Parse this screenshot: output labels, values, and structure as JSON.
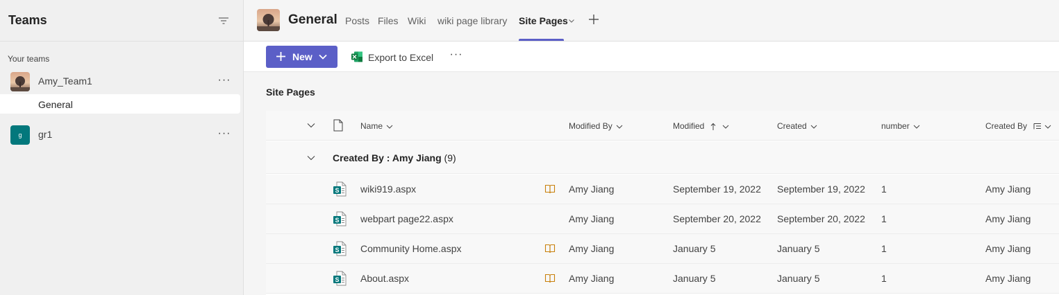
{
  "sidebar": {
    "title": "Teams",
    "section_label": "Your teams",
    "teams": [
      {
        "name": "Amy_Team1",
        "channels": [
          "General"
        ]
      },
      {
        "name": "gr1",
        "avatar_letter": "g"
      }
    ]
  },
  "header": {
    "channel_title": "General",
    "tabs": [
      "Posts",
      "Files",
      "Wiki",
      "wiki page library",
      "Site Pages"
    ],
    "active_tab": "Site Pages"
  },
  "toolbar": {
    "new_label": "New",
    "export_label": "Export to Excel"
  },
  "list": {
    "title": "Site Pages",
    "columns": {
      "name": "Name",
      "modified_by": "Modified By",
      "modified": "Modified",
      "created": "Created",
      "number": "number",
      "created_by": "Created By"
    },
    "group": {
      "label": "Created By : Amy Jiang",
      "count": "(9)"
    },
    "rows": [
      {
        "name": "wiki919.aspx",
        "modified_by": "Amy Jiang",
        "modified": "September 19, 2022",
        "created": "September 19, 2022",
        "number": "1",
        "created_by": "Amy Jiang",
        "has_book": true
      },
      {
        "name": "webpart page22.aspx",
        "modified_by": "Amy Jiang",
        "modified": "September 20, 2022",
        "created": "September 20, 2022",
        "number": "1",
        "created_by": "Amy Jiang",
        "has_book": false
      },
      {
        "name": "Community Home.aspx",
        "modified_by": "Amy Jiang",
        "modified": "January 5",
        "created": "January 5",
        "number": "1",
        "created_by": "Amy Jiang",
        "has_book": true
      },
      {
        "name": "About.aspx",
        "modified_by": "Amy Jiang",
        "modified": "January 5",
        "created": "January 5",
        "number": "1",
        "created_by": "Amy Jiang",
        "has_book": true
      }
    ]
  },
  "colors": {
    "accent": "#5b5fc7",
    "excel_green": "#107c41",
    "sharepoint_teal": "#03787c",
    "book_orange": "#c87f0a"
  },
  "icons": [
    "filter-icon",
    "more-icon",
    "chevron-down-icon",
    "add-icon",
    "excel-icon",
    "file-icon",
    "sharepoint-page-icon",
    "book-icon",
    "sort-up-icon",
    "group-by-icon"
  ]
}
